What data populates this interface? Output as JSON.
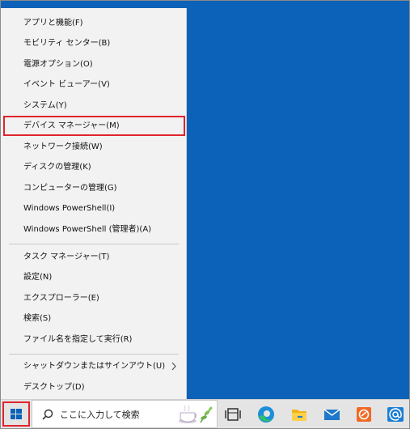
{
  "menu": {
    "items": [
      {
        "label": "アプリと機能(F)"
      },
      {
        "label": "モビリティ センター(B)"
      },
      {
        "label": "電源オプション(O)"
      },
      {
        "label": "イベント ビューアー(V)"
      },
      {
        "label": "システム(Y)"
      },
      {
        "label": "デバイス マネージャー(M)"
      },
      {
        "label": "ネットワーク接続(W)"
      },
      {
        "label": "ディスクの管理(K)"
      },
      {
        "label": "コンピューターの管理(G)"
      },
      {
        "label": "Windows PowerShell(I)"
      },
      {
        "label": "Windows PowerShell (管理者)(A)"
      },
      {
        "label": "タスク マネージャー(T)"
      },
      {
        "label": "設定(N)"
      },
      {
        "label": "エクスプローラー(E)"
      },
      {
        "label": "検索(S)"
      },
      {
        "label": "ファイル名を指定して実行(R)"
      },
      {
        "label": "シャットダウンまたはサインアウト(U)"
      },
      {
        "label": "デスクトップ(D)"
      }
    ]
  },
  "taskbar": {
    "search_placeholder": "ここに入力して検索",
    "icons": [
      "windows-logo-icon",
      "search-icon",
      "tea-cup-icon",
      "task-view-icon",
      "edge-icon",
      "file-explorer-icon",
      "mail-icon",
      "orange-app-icon",
      "at-sign-app-icon"
    ]
  },
  "colors": {
    "desktop": "#0b62b8",
    "highlight_border": "#e0242c",
    "menu_bg": "#f2f2f2",
    "taskbar_bg": "#e4e4e4"
  }
}
